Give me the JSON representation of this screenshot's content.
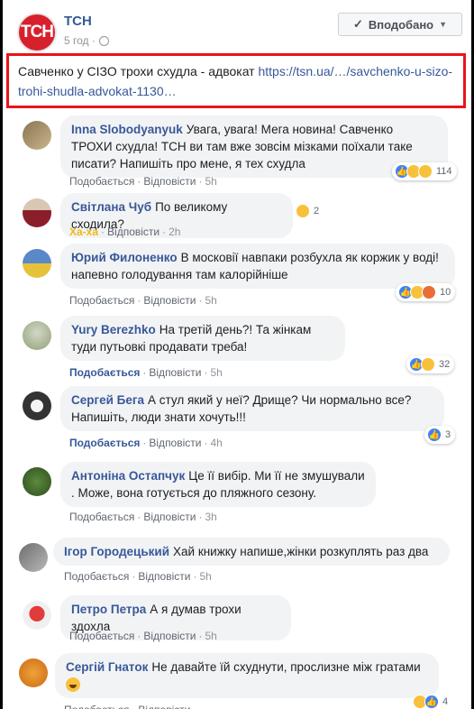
{
  "post": {
    "page_name": "ТСН",
    "avatar_text": "ТСН",
    "time": "5 год ·",
    "follow_label": "Вподобано",
    "text": "Савченко у СІЗО трохи схудла - адвокат",
    "link": "https://tsn.ua/…/savchenko-u-sizo-trohi-shudla-advokat-1130…"
  },
  "labels": {
    "like": "Подобається",
    "reply": "Відповісти",
    "haha": "Ха-ха"
  },
  "comments": [
    {
      "author": "Inna Slobodyanyuk",
      "text": "Увага, увага! Мега новина! Савченко ТРОХИ схудла! ТСН ви там вже зовсім мізками поїхали таке писати? Напишіть про мене, я тех схудла",
      "time": "5h",
      "reactions": [
        "like",
        "haha",
        "haha"
      ],
      "count": "114"
    },
    {
      "author": "Світлана Чуб",
      "text": "По великому сходила?",
      "time": "2h",
      "reactions": [
        "haha"
      ],
      "count": "2"
    },
    {
      "author": "Юрий Филоненко",
      "text": "В московії навпаки розбухла як коржик у воді! напевно голодування там калорійніше",
      "time": "5h",
      "reactions": [
        "like",
        "haha",
        "angry"
      ],
      "count": "10"
    },
    {
      "author": "Yury Berezhko",
      "text": "На третій день?! Та жінкам туди путьовкі продавати треба!",
      "time": "5h",
      "reactions": [
        "like",
        "haha"
      ],
      "count": "32"
    },
    {
      "author": "Сергей Бега",
      "text": "А стул який у неї? Дрище? Чи нормально все? Напишіть, люди знати хочуть!!!",
      "time": "4h",
      "reactions": [
        "like"
      ],
      "count": "3"
    },
    {
      "author": "Антоніна Остапчук",
      "text": "Це її вибір. Ми її не змушували . Може, вона готується до пляжного сезону.",
      "time": "3h"
    },
    {
      "author": "Ігор Городецький",
      "text": "Хай книжку напише,жінки розкуплять раз два",
      "time": "5h"
    },
    {
      "author": "Петро Петра",
      "text": "А я думав трохи здохла",
      "time": "5h"
    },
    {
      "author": "Сергій Гнаток",
      "text": "Не давайте їй схуднути, прослизне між гратами",
      "time": "",
      "reactions": [
        "haha",
        "like"
      ],
      "count": "4"
    }
  ]
}
